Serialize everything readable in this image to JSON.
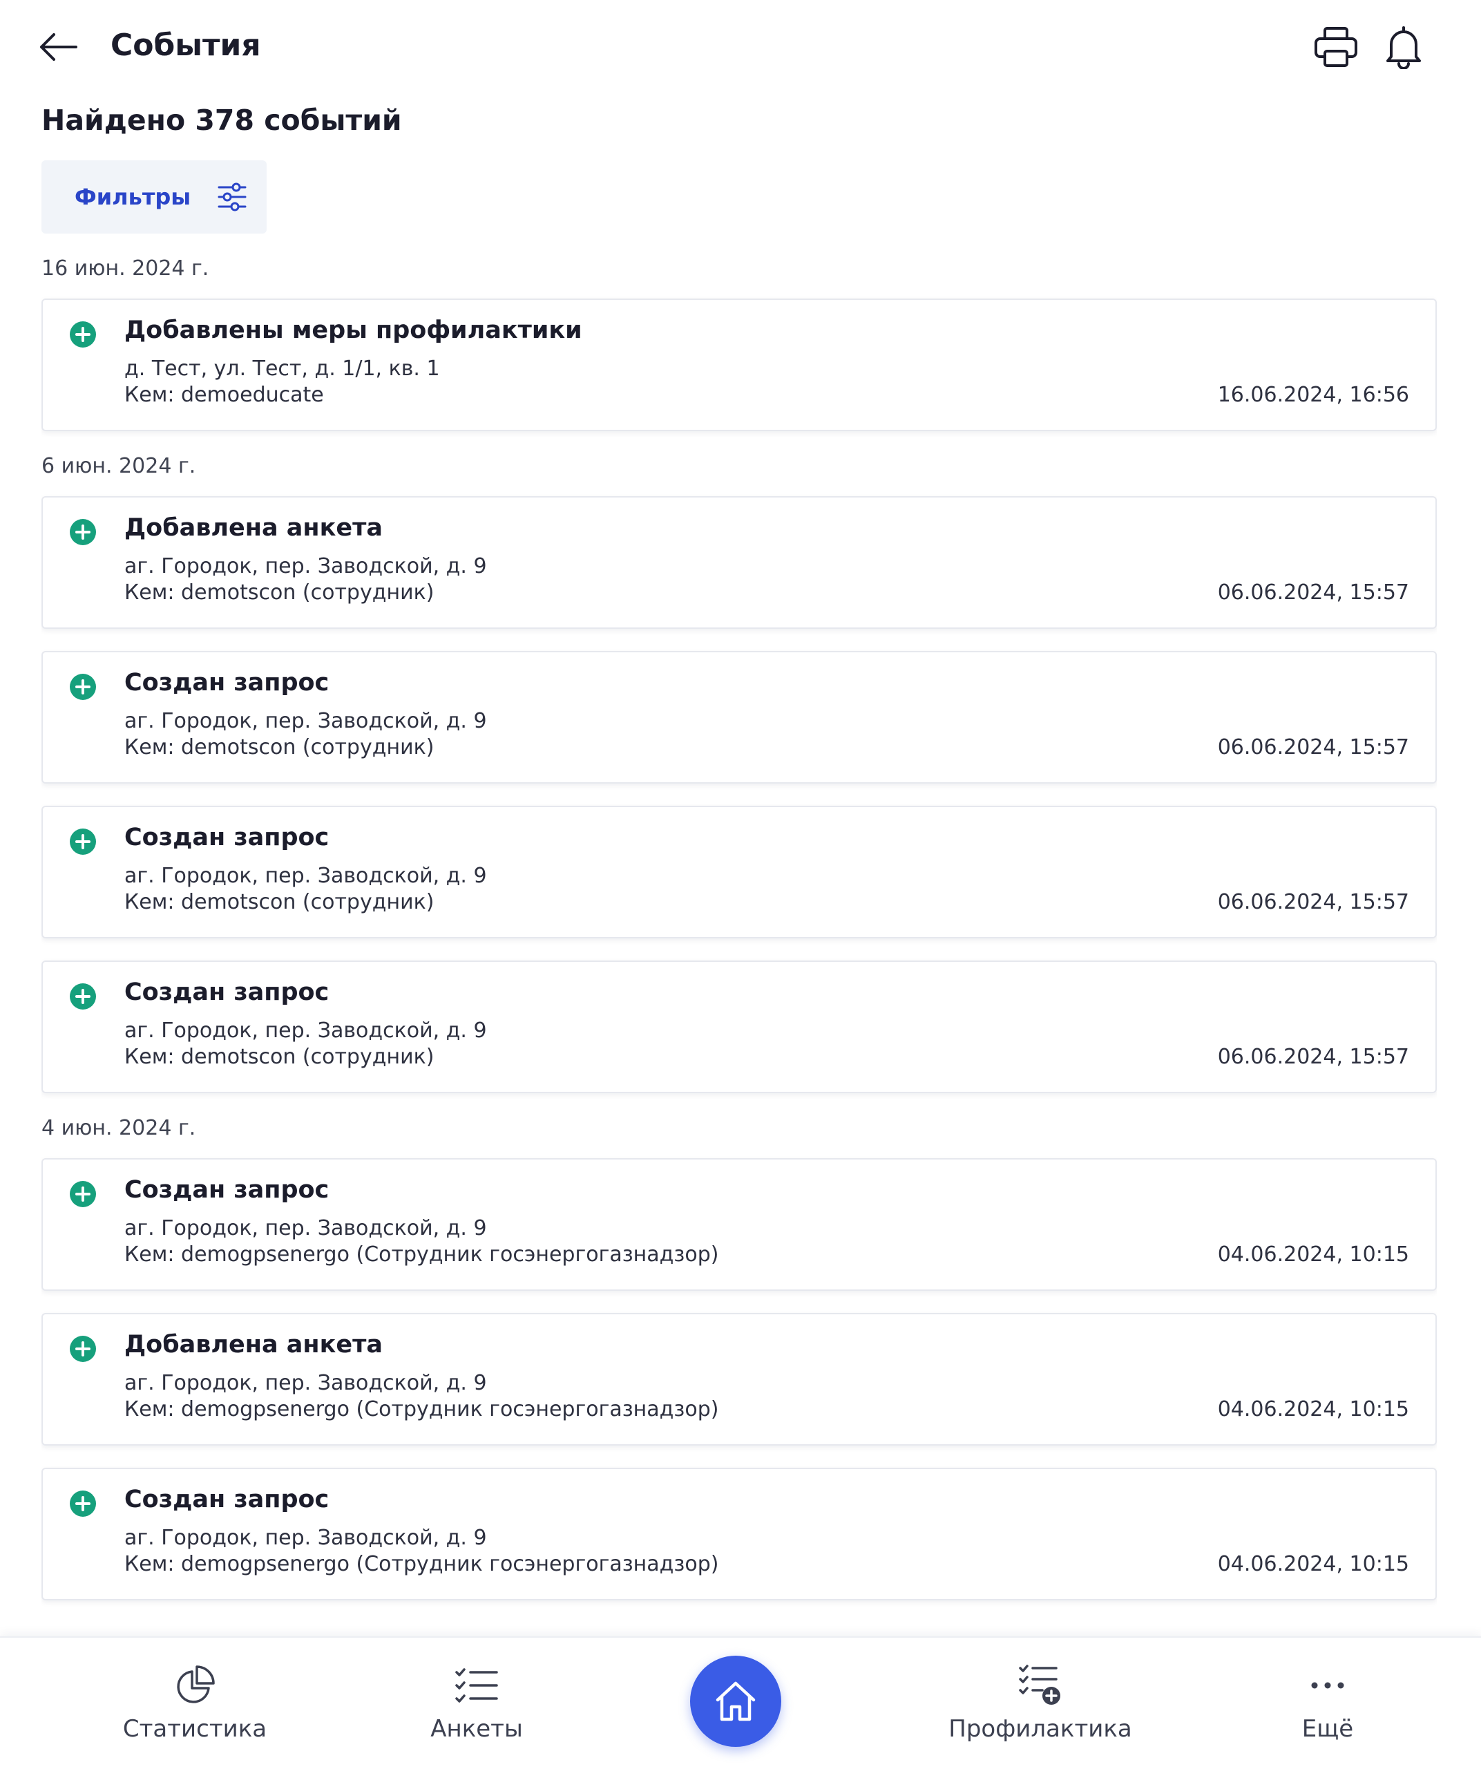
{
  "header": {
    "title": "События",
    "back_icon": "arrow-left-icon",
    "print_icon": "printer-icon",
    "bell_icon": "bell-icon"
  },
  "summary": {
    "found": "Найдено 378 событий"
  },
  "filters": {
    "label": "Фильтры",
    "icon": "sliders-icon"
  },
  "groups": [
    {
      "date": "16 июн. 2024 г.",
      "events": [
        {
          "title": "Добавлены меры профилактики",
          "address": "д. Тест, ул. Тест, д. 1/1, кв. 1",
          "by": "Кем: demoeducate",
          "time": "16.06.2024, 16:56"
        }
      ]
    },
    {
      "date": "6 июн. 2024 г.",
      "events": [
        {
          "title": "Добавлена анкета",
          "address": "аг. Городок, пер. Заводской, д. 9",
          "by": "Кем: demotscon (сотрудник)",
          "time": "06.06.2024, 15:57"
        },
        {
          "title": "Создан запрос",
          "address": "аг. Городок, пер. Заводской, д. 9",
          "by": "Кем: demotscon (сотрудник)",
          "time": "06.06.2024, 15:57"
        },
        {
          "title": "Создан запрос",
          "address": "аг. Городок, пер. Заводской, д. 9",
          "by": "Кем: demotscon (сотрудник)",
          "time": "06.06.2024, 15:57"
        },
        {
          "title": "Создан запрос",
          "address": "аг. Городок, пер. Заводской, д. 9",
          "by": "Кем: demotscon (сотрудник)",
          "time": "06.06.2024, 15:57"
        }
      ]
    },
    {
      "date": "4 июн. 2024 г.",
      "events": [
        {
          "title": "Создан запрос",
          "address": "аг. Городок, пер. Заводской, д. 9",
          "by": "Кем: demogpsenergo (Сотрудник госэнергогазнадзор)",
          "time": "04.06.2024, 10:15"
        },
        {
          "title": "Добавлена анкета",
          "address": "аг. Городок, пер. Заводской, д. 9",
          "by": "Кем: demogpsenergo (Сотрудник госэнергогазнадзор)",
          "time": "04.06.2024, 10:15"
        },
        {
          "title": "Создан запрос",
          "address": "аг. Городок, пер. Заводской, д. 9",
          "by": "Кем: demogpsenergo (Сотрудник госэнергогазнадзор)",
          "time": "04.06.2024, 10:15"
        }
      ]
    }
  ],
  "nav": {
    "items": [
      {
        "label": "Статистика",
        "icon": "pie-chart-icon"
      },
      {
        "label": "Анкеты",
        "icon": "checklist-icon"
      },
      {
        "label": "",
        "icon": "home-icon"
      },
      {
        "label": "Профилактика",
        "icon": "checklist-add-icon"
      },
      {
        "label": "Ещё",
        "icon": "more-dots-icon"
      }
    ]
  },
  "colors": {
    "accent": "#3a5ce6",
    "filter_text": "#2a45c8",
    "event_icon": "#16a07c",
    "filter_bg": "#f1f4f9"
  }
}
